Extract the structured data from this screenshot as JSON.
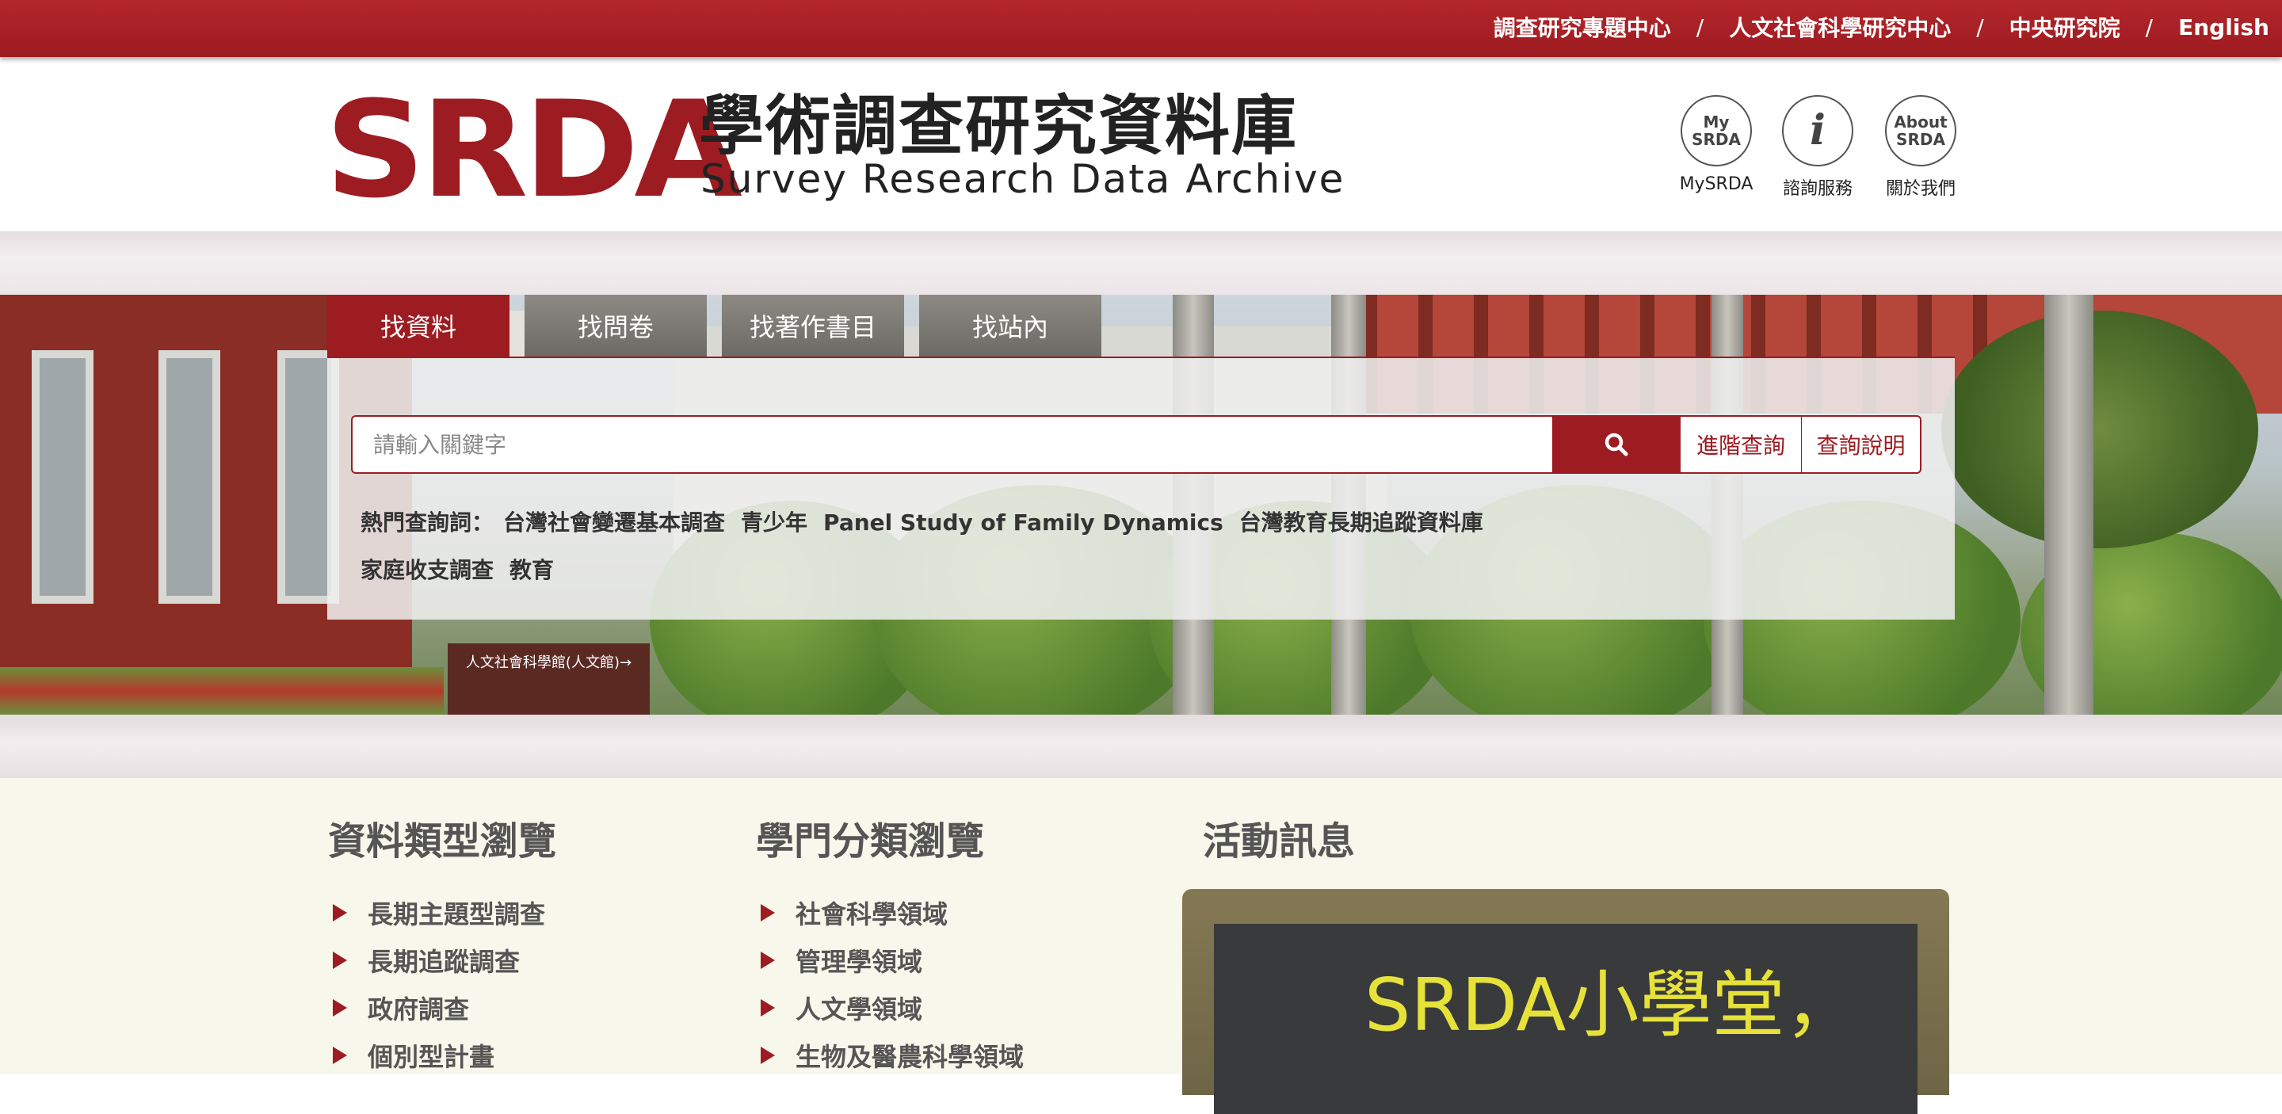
{
  "top_nav": {
    "links": [
      "調查研究專題中心",
      "人文社會科學研究中心",
      "中央研究院",
      "English"
    ],
    "separator": "/"
  },
  "logo": {
    "mark": "SRDA",
    "title_zh": "學術調查研究資料庫",
    "title_en": "Survey Research Data Archive"
  },
  "quick_links": [
    {
      "icon_text": "My\nSRDA",
      "label": "MySRDA",
      "icon": "my-srda-icon"
    },
    {
      "icon_text": "i",
      "label": "諮詢服務",
      "icon": "info-icon"
    },
    {
      "icon_text": "About\nSRDA",
      "label": "關於我們",
      "icon": "about-srda-icon"
    }
  ],
  "search": {
    "tabs": [
      "找資料",
      "找問卷",
      "找著作書目",
      "找站內"
    ],
    "active_tab": 0,
    "placeholder": "請輸入關鍵字",
    "advanced_label": "進階查詢",
    "help_label": "查詢說明",
    "hot_label": "熱門查詢詞：",
    "hot_keywords": [
      "台灣社會變遷基本調查",
      "青少年",
      "Panel Study of Family Dynamics",
      "台灣教育長期追蹤資料庫",
      "家庭收支調查",
      "教育"
    ]
  },
  "sections": {
    "data_types": {
      "title": "資料類型瀏覽",
      "items": [
        "長期主題型調查",
        "長期追蹤調查",
        "政府調查",
        "個別型計畫"
      ]
    },
    "disciplines": {
      "title": "學門分類瀏覽",
      "items": [
        "社會科學領域",
        "管理學領域",
        "人文學領域",
        "生物及醫農科學領域"
      ]
    },
    "events": {
      "title": "活動訊息",
      "banner_text": "SRDA小學堂，"
    }
  },
  "hero_sign": "人文社會科學館(人文館)→"
}
